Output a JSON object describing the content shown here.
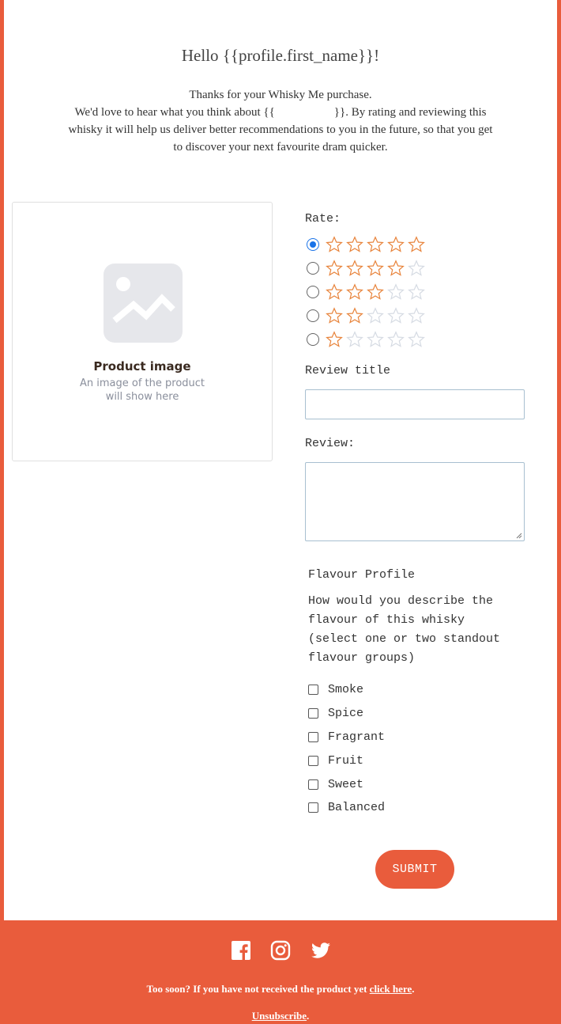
{
  "greeting": "Hello {{profile.first_name}}!",
  "intro": {
    "line1": "Thanks for your Whisky Me purchase.",
    "line2": "We'd love to hear what you think about {{                    }}. By rating and reviewing this",
    "line3": "whisky it will help us deliver better recommendations to you in the future, so that you get",
    "line4": "to discover your next favourite dram quicker."
  },
  "product_card": {
    "title": "Product image",
    "subtitle_line1": "An image of the product",
    "subtitle_line2": "will show here",
    "icon": "image-placeholder-icon"
  },
  "rating": {
    "label": "Rate:",
    "options": [
      {
        "stars": 5,
        "selected": true
      },
      {
        "stars": 4,
        "selected": false
      },
      {
        "stars": 3,
        "selected": false
      },
      {
        "stars": 2,
        "selected": false
      },
      {
        "stars": 1,
        "selected": false
      }
    ],
    "star_max": 5,
    "star_color": "#e8843c",
    "star_empty_color": "#d6dbe3"
  },
  "review_title": {
    "label": "Review title",
    "value": ""
  },
  "review": {
    "label": "Review:",
    "value": ""
  },
  "flavour": {
    "title": "Flavour Profile",
    "question_line1": "How would you describe the",
    "question_line2": "flavour of this whisky",
    "question_line3": "(select one or two standout",
    "question_line4": "flavour groups)",
    "options": [
      "Smoke",
      "Spice",
      "Fragrant",
      "Fruit",
      "Sweet",
      "Balanced"
    ]
  },
  "submit_label": "SUBMIT",
  "footer": {
    "social": [
      "facebook-icon",
      "instagram-icon",
      "twitter-icon"
    ],
    "note_prefix": "Too soon? If you have not received the product yet ",
    "note_link": "click here",
    "note_suffix": ".",
    "unsubscribe": "Unsubscribe",
    "unsubscribe_suffix": "."
  },
  "colors": {
    "accent": "#e95c3c",
    "radio_selected": "#1a73e8"
  }
}
